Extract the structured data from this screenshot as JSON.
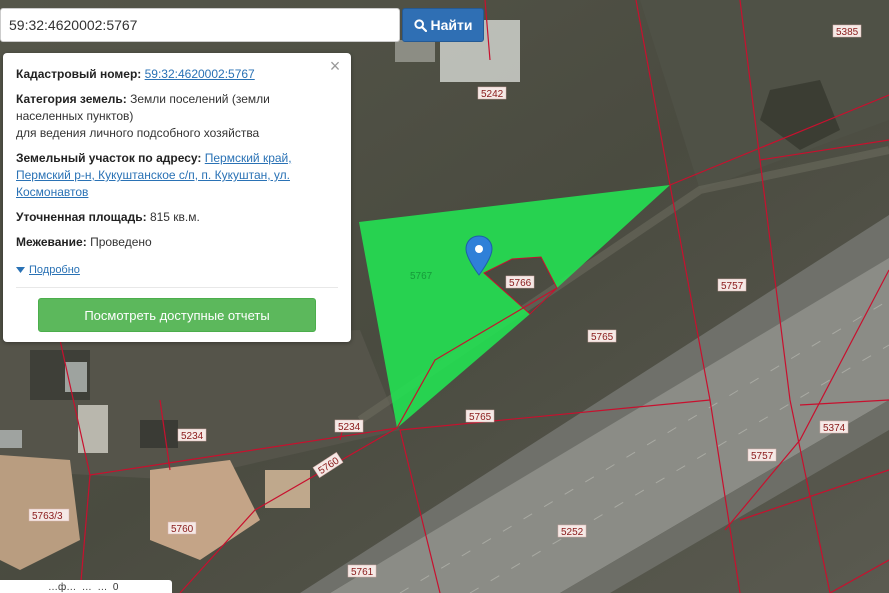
{
  "search": {
    "value": "59:32:4620002:5767",
    "button_label": "Найти",
    "button_icon": "search-icon"
  },
  "card": {
    "cadastral_label": "Кадастровый номер:",
    "cadastral_value": "59:32:4620002:5767",
    "category_label": "Категория земель:",
    "category_value": "Земли поселений (земли населенных пунктов)",
    "category_value2": "для ведения личного подсобного хозяйства",
    "address_label": "Земельный участок по адресу:",
    "address_value": "Пермский край, Пермский р-н, Кукуштанское с/п, п. Кукуштан, ул. Космонавтов",
    "area_label": "Уточненная площадь:",
    "area_value": "815 кв.м.",
    "survey_label": "Межевание:",
    "survey_value": "Проведено",
    "details_label": "Подробно",
    "reports_button": "Посмотреть доступные отчеты",
    "close_icon": "close-icon"
  },
  "map": {
    "selected_parcel": "5767",
    "highlight_color": "#22e552",
    "boundary_color": "#c8102e",
    "marker_color": "#2f80d8",
    "parcel_labels": [
      "5385",
      "5242",
      "5767",
      "5766",
      "5757",
      "5765",
      "5765",
      "5234",
      "5234",
      "5760",
      "5763/3",
      "5760",
      "5252",
      "5761",
      "5757",
      "5374"
    ]
  },
  "bottom": {
    "text": "…ф…  …  …  0"
  }
}
